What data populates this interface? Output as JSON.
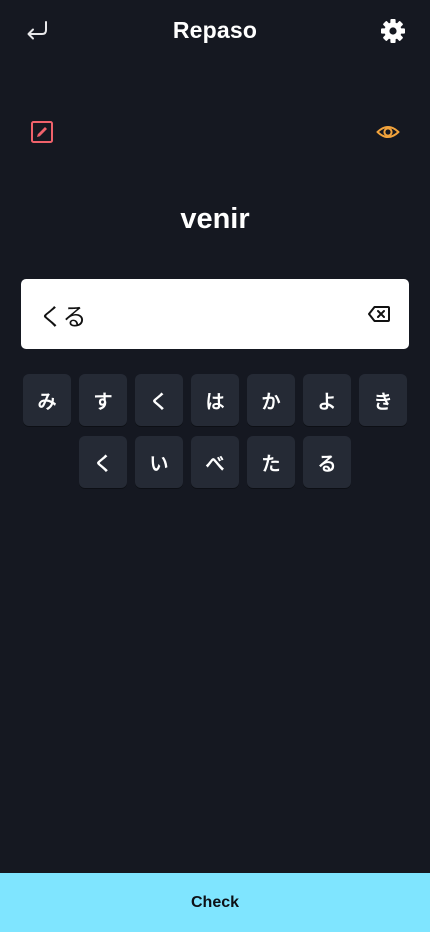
{
  "header": {
    "title": "Repaso",
    "back_icon": "return-arrow-icon",
    "settings_icon": "gear-icon"
  },
  "tools": {
    "edit_icon": "edit-pencil-icon",
    "edit_color": "#f0626b",
    "reveal_icon": "eye-icon",
    "reveal_color": "#f2a33c"
  },
  "prompt": {
    "word": "venir"
  },
  "answer": {
    "value": "くる",
    "clear_icon": "backspace-icon"
  },
  "keyboard": {
    "row1": [
      "み",
      "す",
      "く",
      "は",
      "か",
      "よ",
      "き"
    ],
    "row2": [
      "く",
      "い",
      "べ",
      "た",
      "る"
    ]
  },
  "footer": {
    "check_label": "Check",
    "accent": "#7fe5ff"
  }
}
